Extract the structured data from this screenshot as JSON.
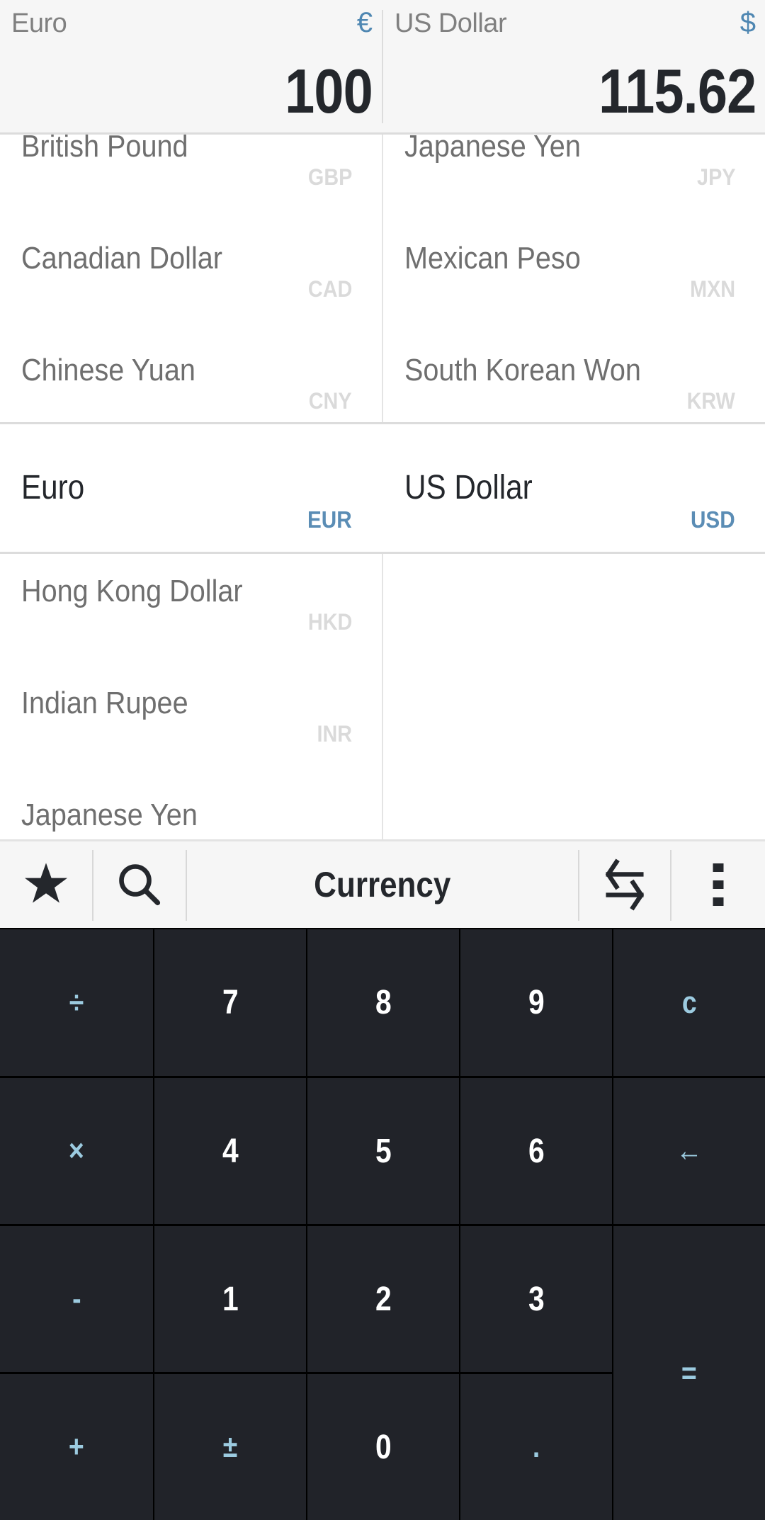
{
  "header": {
    "from": {
      "name": "Euro",
      "symbol": "€",
      "value": "100"
    },
    "to": {
      "name": "US Dollar",
      "symbol": "$",
      "value": "115.62"
    }
  },
  "list_top": {
    "left": [
      {
        "name": "British Pound",
        "code": "GBP"
      },
      {
        "name": "Canadian Dollar",
        "code": "CAD"
      },
      {
        "name": "Chinese Yuan",
        "code": "CNY"
      }
    ],
    "right": [
      {
        "name": "Japanese Yen",
        "code": "JPY"
      },
      {
        "name": "Mexican Peso",
        "code": "MXN"
      },
      {
        "name": "South Korean Won",
        "code": "KRW"
      }
    ]
  },
  "selected": {
    "left": {
      "name": "Euro",
      "code": "EUR"
    },
    "right": {
      "name": "US Dollar",
      "code": "USD"
    }
  },
  "list_bottom": {
    "left": [
      {
        "name": "Hong Kong Dollar",
        "code": "HKD"
      },
      {
        "name": "Indian Rupee",
        "code": "INR"
      },
      {
        "name": "Japanese Yen",
        "code": ""
      }
    ],
    "right": []
  },
  "toolbar": {
    "title": "Currency",
    "icons": [
      "star-icon",
      "search-icon",
      "swap-icon",
      "more-vert-icon"
    ]
  },
  "keypad": {
    "keys": [
      {
        "label": "÷",
        "type": "op",
        "name": "key-divide"
      },
      {
        "label": "7",
        "type": "num",
        "name": "key-7"
      },
      {
        "label": "8",
        "type": "num",
        "name": "key-8"
      },
      {
        "label": "9",
        "type": "num",
        "name": "key-9"
      },
      {
        "label": "c",
        "type": "op",
        "name": "key-clear"
      },
      {
        "label": "×",
        "type": "op",
        "name": "key-multiply"
      },
      {
        "label": "4",
        "type": "num",
        "name": "key-4"
      },
      {
        "label": "5",
        "type": "num",
        "name": "key-5"
      },
      {
        "label": "6",
        "type": "num",
        "name": "key-6"
      },
      {
        "label": "←",
        "type": "op",
        "name": "key-backspace"
      },
      {
        "label": "-",
        "type": "op",
        "name": "key-subtract"
      },
      {
        "label": "1",
        "type": "num",
        "name": "key-1"
      },
      {
        "label": "2",
        "type": "num",
        "name": "key-2"
      },
      {
        "label": "3",
        "type": "num",
        "name": "key-3"
      },
      {
        "label": "=",
        "type": "op",
        "name": "key-equals"
      },
      {
        "label": "+",
        "type": "op",
        "name": "key-add"
      },
      {
        "label": "±",
        "type": "op",
        "name": "key-plus-minus"
      },
      {
        "label": "0",
        "type": "num",
        "name": "key-0"
      },
      {
        "label": ".",
        "type": "op",
        "name": "key-decimal"
      }
    ]
  },
  "colors": {
    "accent": "#5b8db5",
    "keypad_bg": "#212329",
    "operator_key": "#9ccbe0",
    "text_dark": "#24272c"
  }
}
